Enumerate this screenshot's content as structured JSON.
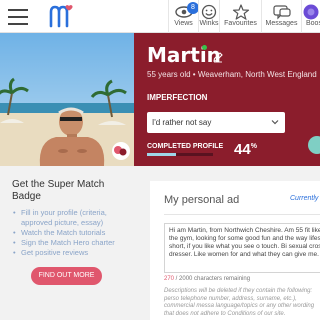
{
  "header": {
    "nav": [
      {
        "label": "Views",
        "icon": "eye-icon",
        "badge": "8"
      },
      {
        "label": "Winks",
        "icon": "smiley-icon"
      },
      {
        "label": "Favourites",
        "icon": "star-icon"
      },
      {
        "label": "Messages",
        "icon": "chat-icon"
      },
      {
        "label": "Boos",
        "icon": "boost-icon"
      }
    ]
  },
  "profile": {
    "name": "Martin",
    "subline": "55 years old • Weaverham,  North West England",
    "imperfection_heading": "IMPERFECTION",
    "imperfection_value": "I'd rather not say",
    "completed_heading": "COMPLETED PROFILE",
    "completed_percent": 44,
    "completed_percent_label": "44",
    "percent_sign": "%"
  },
  "super_match": {
    "title": "Get the Super Match Badge",
    "items": [
      "Fill in your profile (criteria, approved picture, essay)",
      "Watch the Match tutorials",
      "Sign the Match Hero charter",
      "Get positive reviews"
    ],
    "button": "FIND OUT MORE"
  },
  "personal_ad": {
    "title": "My personal ad",
    "status": "Currently",
    "text": "Hi am Martin, from Northwich Cheshire. Am 55 fit like the gym, looking for some good fun and the way lifes to short, if you like what you see o touch.  Bi sexual cross dresser.  Like women for and what they can give me.",
    "count": "270",
    "count_suffix": " / 2000 characters remaining",
    "rules": "Descriptions will be deleted if they contain the following: perso telephone number, address, surname, etc.), commercial messa language/topics or any other wording that does not adhere to Conditions of our site."
  },
  "colors": {
    "panel": "#8b1d2c",
    "accent_button": "#e0576d",
    "link": "#8aa4c8",
    "badge": "#2a6fdb"
  }
}
